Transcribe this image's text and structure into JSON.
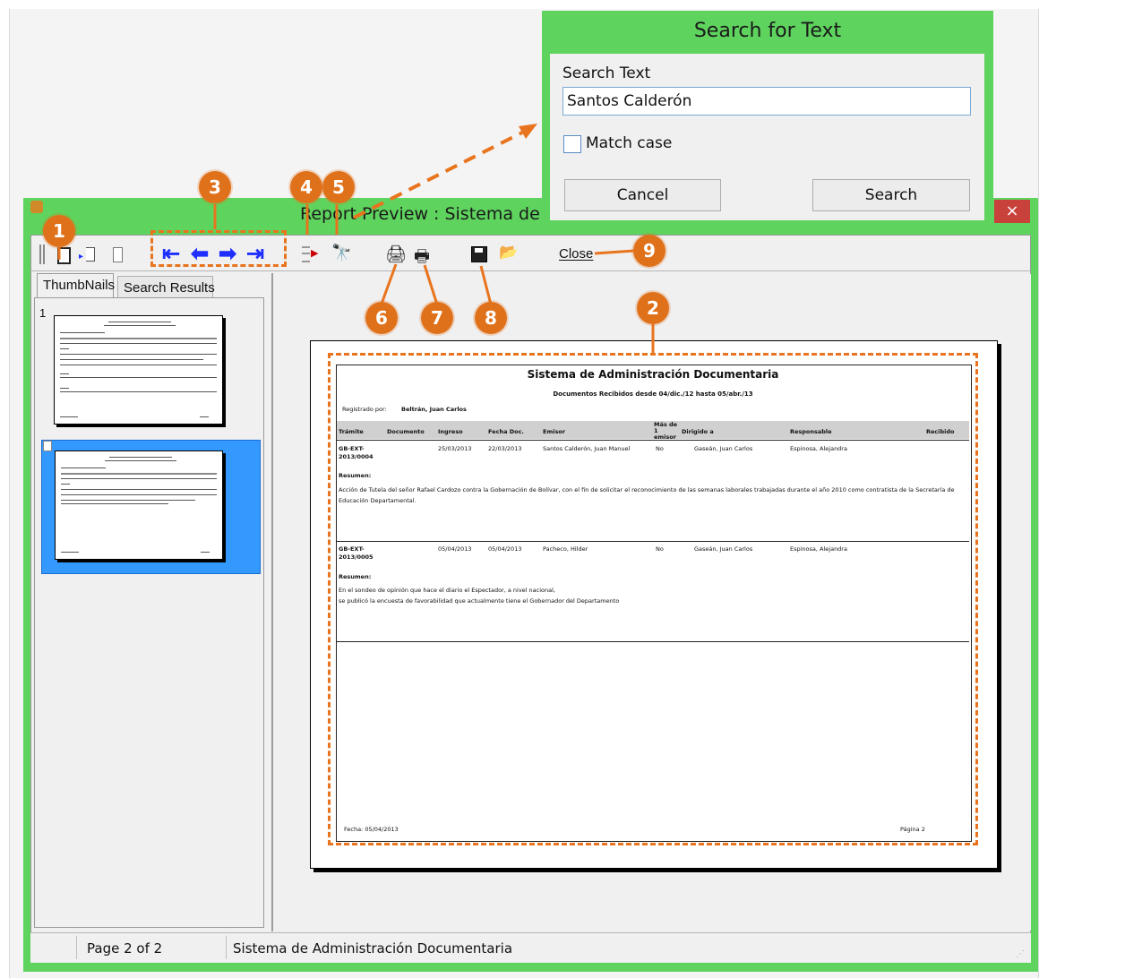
{
  "search_dialog": {
    "title": "Search for Text",
    "search_text_label": "Search Text",
    "search_text_value": "Santos Calderón",
    "match_case_label": "Match case",
    "match_case_checked": false,
    "cancel_label": "Cancel",
    "search_label": "Search"
  },
  "window": {
    "title": "Report Preview : Sistema de Ad",
    "close_glyph": "×"
  },
  "toolbar": {
    "close_label": "Close",
    "icons": [
      "one-page-icon",
      "two-page-icon",
      "fit-width-icon",
      "first-page-icon",
      "previous-page-icon",
      "next-page-icon",
      "last-page-icon",
      "goto-page-icon",
      "find-icon",
      "print-setup-icon",
      "print-icon",
      "save-icon",
      "open-icon"
    ]
  },
  "left_pane": {
    "tabs": [
      "ThumbNails",
      "Search Results"
    ],
    "active_tab": "ThumbNails",
    "thumbnail_page_number": "1",
    "selected_thumbnail": 2
  },
  "report": {
    "title": "Sistema de Administración Documentaria",
    "subtitle": "Documentos Recibidos desde 04/dic./12 hasta 05/abr./13",
    "registered_by_label": "Registrado por:",
    "registered_by_value": "Beltrán, Juan Carlos",
    "columns": [
      "Trámite",
      "Documento",
      "Ingreso",
      "Fecha Doc.",
      "Emisor",
      "Más de 1 emisor",
      "Dirigido a",
      "Responsable",
      "Recibido"
    ],
    "rows": [
      {
        "tramite": "GB-EXT-2013/0004",
        "ingreso": "25/03/2013",
        "fecha_doc": "22/03/2013",
        "emisor": "Santos Calderón, Juan Manuel",
        "mas_emisor": "No",
        "dirigido": "Gaseán, Juan Carlos",
        "responsable": "Espinosa, Alejandra",
        "resumen_label": "Resumen:",
        "resumen": "Acción de Tutela del señor Rafael Cardozo contra la Gobernación de Bolívar, con el fin de solicitar el reconocimiento de las semanas laborales trabajadas durante el año 2010 como contratista de la Secretaría de Educación Departamental."
      },
      {
        "tramite": "GB-EXT-2013/0005",
        "ingreso": "05/04/2013",
        "fecha_doc": "05/04/2013",
        "emisor": "Pacheco, Hilder",
        "mas_emisor": "No",
        "dirigido": "Gaseán, Juan Carlos",
        "responsable": "Espinosa, Alejandra",
        "resumen_label": "Resumen:",
        "resumen_line1": "En el sondeo de opinión que hace el diario el Espectador, a nivel nacional,",
        "resumen_line2": "se publicó la encuesta de favorabilidad que actualmente tiene el Gobernador del Departamento"
      }
    ],
    "footer_date": "Fecha: 05/04/2013",
    "footer_page": "Página 2"
  },
  "status_bar": {
    "page_info": "Page 2 of 2",
    "report_name": "Sistema de Administración Documentaria"
  },
  "callouts": [
    "1",
    "2",
    "3",
    "4",
    "5",
    "6",
    "7",
    "8",
    "9"
  ],
  "colors": {
    "window_frame": "#5ed35e",
    "callout": "#e0711b",
    "nav_arrow": "#1f2fff",
    "thumbnail_selected": "#3399ff"
  }
}
